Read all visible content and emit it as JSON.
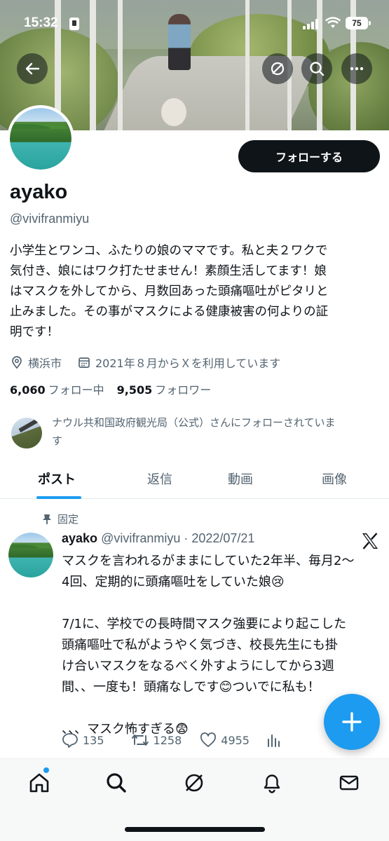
{
  "status_bar": {
    "time": "15:32",
    "battery": "75"
  },
  "profile": {
    "follow_button": "フォローする",
    "name": "ayako",
    "handle": "@vivifranmiyu",
    "bio_lines": [
      "小学生とワンコ、ふたりの娘のママです。私と夫２ワクで",
      "気付き、娘にはワク打たせません！素顔生活してます！娘",
      "はマスクを外してから、月数回あった頭痛嘔吐がピタリと",
      "止みました。その事がマスクによる健康被害の何よりの証",
      "明です！"
    ],
    "location": "横浜市",
    "joined": "2021年８月からＸを利用しています",
    "following_count": "6,060",
    "following_label": "フォロー中",
    "followers_count": "9,505",
    "followers_label": "フォロワー",
    "followed_by_lines": [
      "ナウル共和国政府観光局（公式）さんにフォローされていま",
      "す"
    ]
  },
  "tabs": [
    {
      "label": "ポスト",
      "active": true
    },
    {
      "label": "返信",
      "active": false
    },
    {
      "label": "動画",
      "active": false
    },
    {
      "label": "画像",
      "active": false
    }
  ],
  "post": {
    "pinned_label": "固定",
    "author_name": "ayako",
    "author_handle_date": "@vivifranmiyu · 2022/07/21",
    "body": "マスクを言われるがままにしていた2年半、毎月2〜\n4回、定期的に頭痛嘔吐をしていた娘😢\n\n7/1に、学校での長時間マスク強要により起こした\n頭痛嘔吐で私がようやく気づき、校長先生にも掛\nけ合いマスクをなるべく外すようにしてから3週\n間、、一度も！頭痛なしです😊ついでに私も！\n\n、、、マスク怖すぎる😨",
    "replies": "135",
    "reposts": "1258",
    "likes": "4955"
  },
  "icons": {
    "back": "back-arrow-icon",
    "grok": "grok-icon",
    "search": "search-icon",
    "more": "more-icon",
    "x_logo": "x-logo-icon",
    "fab": "plus-icon"
  },
  "colors": {
    "accent": "#1d9bf0",
    "text": "#0f1419",
    "muted": "#536471"
  }
}
